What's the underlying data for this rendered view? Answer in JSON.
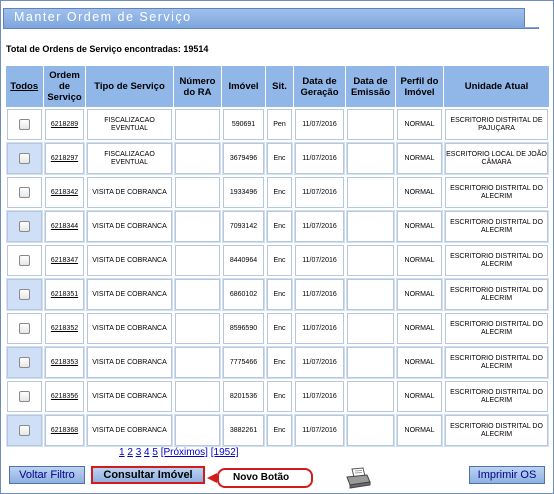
{
  "title": "Manter Ordem de Serviço",
  "total_label": "Total de Ordens de Serviço encontradas: 19514",
  "headers": {
    "todos": "Todos",
    "ordem": "Ordem de Serviço",
    "tipo": "Tipo de Serviço",
    "numero_ra": "Número do RA",
    "imovel": "Imóvel",
    "sit": "Sit.",
    "data_geracao": "Data de Geração",
    "data_emissao": "Data de Emissão",
    "perfil": "Perfil do Imóvel",
    "unidade": "Unidade Atual"
  },
  "rows": [
    {
      "os": "6218289",
      "tipo": "FISCALIZACAO EVENTUAL",
      "ra": "",
      "imovel": "590691",
      "sit": "Pen",
      "geracao": "11/07/2016",
      "emissao": "",
      "perfil": "NORMAL",
      "unidade": "ESCRITORIO DISTRITAL DE PAJUÇARA"
    },
    {
      "os": "6218297",
      "tipo": "FISCALIZACAO EVENTUAL",
      "ra": "",
      "imovel": "3679496",
      "sit": "Enc",
      "geracao": "11/07/2016",
      "emissao": "",
      "perfil": "NORMAL",
      "unidade": "ESCRITORIO LOCAL DE JOÃO CÂMARA"
    },
    {
      "os": "6218342",
      "tipo": "VISITA DE COBRANCA",
      "ra": "",
      "imovel": "1933496",
      "sit": "Enc",
      "geracao": "11/07/2016",
      "emissao": "",
      "perfil": "NORMAL",
      "unidade": "ESCRITORIO DISTRITAL DO ALECRIM"
    },
    {
      "os": "6218344",
      "tipo": "VISITA DE COBRANCA",
      "ra": "",
      "imovel": "7093142",
      "sit": "Enc",
      "geracao": "11/07/2016",
      "emissao": "",
      "perfil": "NORMAL",
      "unidade": "ESCRITORIO DISTRITAL DO ALECRIM"
    },
    {
      "os": "6218347",
      "tipo": "VISITA DE COBRANCA",
      "ra": "",
      "imovel": "8440964",
      "sit": "Enc",
      "geracao": "11/07/2016",
      "emissao": "",
      "perfil": "NORMAL",
      "unidade": "ESCRITORIO DISTRITAL DO ALECRIM"
    },
    {
      "os": "6218351",
      "tipo": "VISITA DE COBRANCA",
      "ra": "",
      "imovel": "6860102",
      "sit": "Enc",
      "geracao": "11/07/2016",
      "emissao": "",
      "perfil": "NORMAL",
      "unidade": "ESCRITORIO DISTRITAL DO ALECRIM"
    },
    {
      "os": "6218352",
      "tipo": "VISITA DE COBRANCA",
      "ra": "",
      "imovel": "8596590",
      "sit": "Enc",
      "geracao": "11/07/2016",
      "emissao": "",
      "perfil": "NORMAL",
      "unidade": "ESCRITORIO DISTRITAL DO ALECRIM"
    },
    {
      "os": "6218353",
      "tipo": "VISITA DE COBRANCA",
      "ra": "",
      "imovel": "7775466",
      "sit": "Enc",
      "geracao": "11/07/2016",
      "emissao": "",
      "perfil": "NORMAL",
      "unidade": "ESCRITORIO DISTRITAL DO ALECRIM"
    },
    {
      "os": "6218356",
      "tipo": "VISITA DE COBRANCA",
      "ra": "",
      "imovel": "8201536",
      "sit": "Enc",
      "geracao": "11/07/2016",
      "emissao": "",
      "perfil": "NORMAL",
      "unidade": "ESCRITORIO DISTRITAL DO ALECRIM"
    },
    {
      "os": "6218368",
      "tipo": "VISITA DE COBRANCA",
      "ra": "",
      "imovel": "3882261",
      "sit": "Enc",
      "geracao": "11/07/2016",
      "emissao": "",
      "perfil": "NORMAL",
      "unidade": "ESCRITORIO DISTRITAL DO ALECRIM"
    }
  ],
  "pagination": {
    "pages": [
      "1",
      "2",
      "3",
      "4",
      "5"
    ],
    "next": "[Próximos]",
    "last": "[1952]"
  },
  "buttons": {
    "voltar": "Voltar Filtro",
    "consultar": "Consultar Imóvel",
    "imprimir": "Imprimir OS"
  },
  "callout": "Novo Botão",
  "icons": {
    "print": "printer-icon",
    "checkbox": "checkbox-icon"
  },
  "colors": {
    "header_bg": "#91b6e8",
    "title_bar": "#8fb2e4",
    "highlight": "#d21c1c"
  }
}
